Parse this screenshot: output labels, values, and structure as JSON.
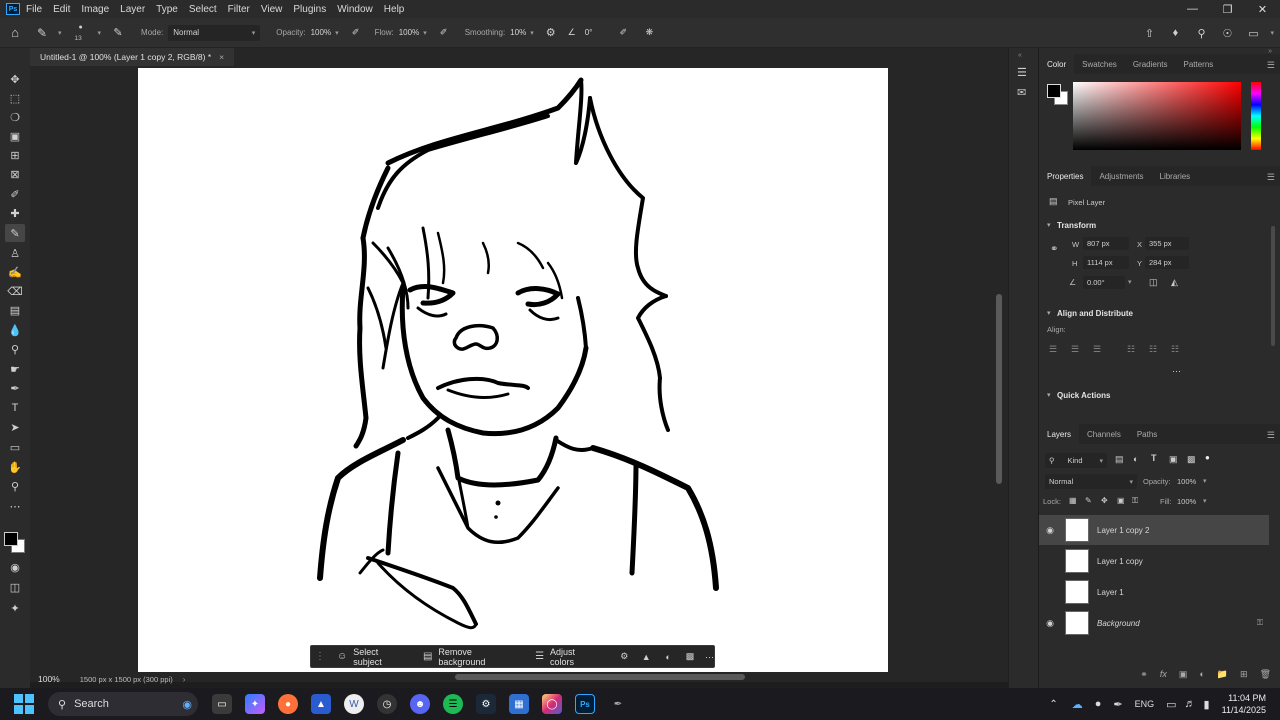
{
  "menubar": {
    "items": [
      "File",
      "Edit",
      "Image",
      "Layer",
      "Type",
      "Select",
      "Filter",
      "View",
      "Plugins",
      "Window",
      "Help"
    ],
    "logo": "Ps"
  },
  "options": {
    "brush_size": "13",
    "mode_label": "Mode:",
    "mode_value": "Normal",
    "opacity_label": "Opacity:",
    "opacity_value": "100%",
    "flow_label": "Flow:",
    "flow_value": "100%",
    "smoothing_label": "Smoothing:",
    "smoothing_value": "10%",
    "angle_value": "0°"
  },
  "document": {
    "tab_title": "Untitled-1 @ 100% (Layer 1 copy 2, RGB/8) *",
    "close": "×"
  },
  "contextual_taskbar": {
    "select_subject": "Select subject",
    "remove_background": "Remove background",
    "adjust_colors": "Adjust colors",
    "more": "···"
  },
  "statusbar": {
    "zoom": "100%",
    "doc_info": "1500 px x 1500 px (300 ppi)"
  },
  "color_panel": {
    "tabs": [
      "Color",
      "Swatches",
      "Gradients",
      "Patterns"
    ]
  },
  "properties_panel": {
    "tabs": [
      "Properties",
      "Adjustments",
      "Libraries"
    ],
    "layer_type": "Pixel Layer",
    "transform_title": "Transform",
    "w_label": "W",
    "w_value": "807 px",
    "h_label": "H",
    "h_value": "1114 px",
    "x_label": "X",
    "x_value": "355 px",
    "y_label": "Y",
    "y_value": "284 px",
    "angle": "0.00°",
    "align_title": "Align and Distribute",
    "align_label": "Align:",
    "more": "···",
    "quick_actions": "Quick Actions"
  },
  "layers_panel": {
    "tabs": [
      "Layers",
      "Channels",
      "Paths"
    ],
    "filter_kind": "Kind",
    "blend_mode": "Normal",
    "opacity_label": "Opacity:",
    "opacity_value": "100%",
    "lock_label": "Lock:",
    "fill_label": "Fill:",
    "fill_value": "100%",
    "layers": [
      {
        "name": "Layer 1 copy 2",
        "visible": true,
        "selected": true
      },
      {
        "name": "Layer 1 copy",
        "visible": false,
        "selected": false
      },
      {
        "name": "Layer 1",
        "visible": false,
        "selected": false
      },
      {
        "name": "Background",
        "visible": true,
        "selected": false,
        "locked": true
      }
    ]
  },
  "taskbar": {
    "search_placeholder": "Search",
    "language": "ENG",
    "time": "11:04 PM",
    "date": "11/14/2025"
  },
  "colors": {
    "accent": "#31a8ff",
    "panel_bg": "#2b2b2b",
    "canvas_bg": "#262626",
    "selected_row": "#464646"
  }
}
